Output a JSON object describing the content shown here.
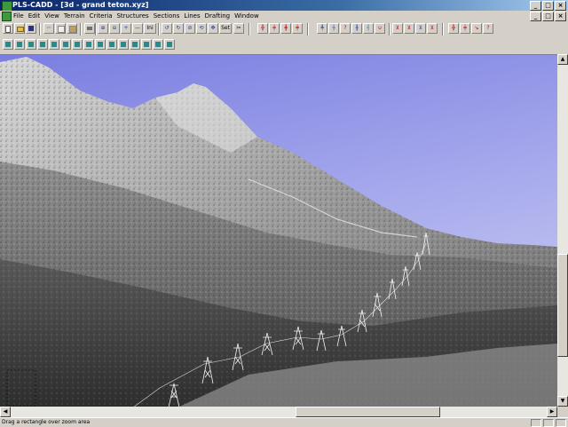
{
  "window": {
    "title": "PLS-CADD - [3d - grand teton.xyz]",
    "controls": [
      "_",
      "□",
      "×"
    ]
  },
  "menubar": {
    "items": [
      "File",
      "Edit",
      "View",
      "Terrain",
      "Criteria",
      "Structures",
      "Sections",
      "Lines",
      "Drafting",
      "Window"
    ],
    "mdi_controls": [
      "_",
      "□",
      "×"
    ]
  },
  "toolbar1": {
    "labels": [
      "Ini",
      "Set"
    ]
  },
  "statusbar": {
    "message": "Drag a rectangle over zoom area"
  },
  "colors": {
    "sky_top": "#7a7ee0",
    "sky_bottom": "#c8caf2",
    "terrain_dark": "#2e2e2e",
    "terrain_mid": "#6a6a6a",
    "terrain_light": "#d8d8d8",
    "tower_wire": "#f2f2f2"
  },
  "icons": [
    "new-icon",
    "open-icon",
    "save-icon",
    "cut-icon",
    "copy-icon",
    "paste-icon",
    "zoom-in-icon",
    "zoom-out-icon",
    "rotate-icon",
    "pan-icon",
    "add-structure-icon",
    "move-structure-icon",
    "delete-structure-icon"
  ]
}
